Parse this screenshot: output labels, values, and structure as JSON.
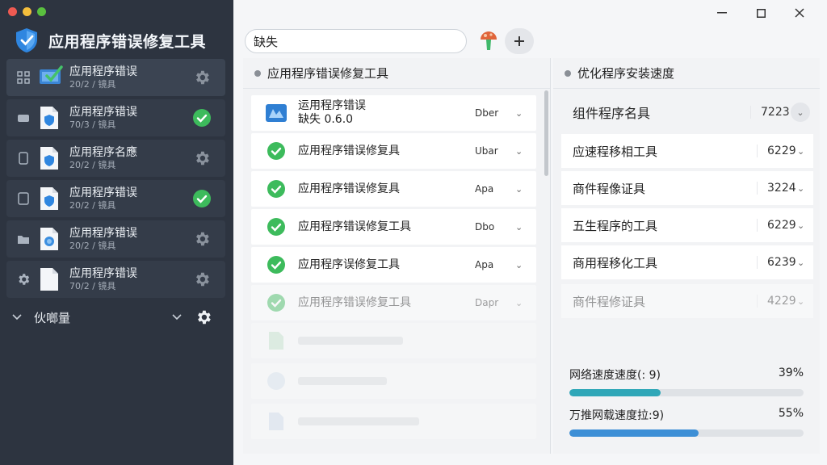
{
  "app": {
    "title": "应用程序错误修复工具"
  },
  "sidebar": {
    "items": [
      {
        "title": "应用程序错误",
        "sub": "20/2 / 镜具",
        "right": "gear-icon",
        "lead": "grid-icon",
        "active": true
      },
      {
        "title": "应用程序错误",
        "sub": "70/3 / 镜具",
        "right": "check-icon",
        "lead": "drive-icon"
      },
      {
        "title": "应用程序名應",
        "sub": "20/2 / 镜具",
        "right": "gear-icon",
        "lead": "phone-icon"
      },
      {
        "title": "应用程序错误",
        "sub": "20/2 / 镜具",
        "right": "check-icon",
        "lead": "tablet-icon"
      },
      {
        "title": "应用程序错误",
        "sub": "20/2 / 镜具",
        "right": "gear-icon",
        "lead": "folder-icon"
      },
      {
        "title": "应用程序错误",
        "sub": "70/2 / 镜具",
        "right": "gear-icon",
        "lead": "gear-icon"
      }
    ],
    "footer_label": "伙啷量"
  },
  "search": {
    "value": "缺失"
  },
  "left_panel": {
    "title": "应用程序错误修复工具",
    "rows": [
      {
        "name": "运用程序错误",
        "name2": "缺失 0.6.0",
        "code": "Dber",
        "icon": "app-icon"
      },
      {
        "name": "应用程序错误修复具",
        "code": "Ubar",
        "icon": "check-icon"
      },
      {
        "name": "应用程序错误修复具",
        "code": "Apa",
        "icon": "check-icon"
      },
      {
        "name": "应用程序错误修复工具",
        "code": "Dbo",
        "icon": "check-icon"
      },
      {
        "name": "应用程序误修复工具",
        "code": "Apa",
        "icon": "check-icon"
      },
      {
        "name": "应用程序错误修复工具",
        "code": "Dapr",
        "icon": "check-icon",
        "faded": true
      }
    ]
  },
  "right_panel": {
    "title": "优化程序安装速度",
    "header": {
      "name": "组件程序名具",
      "value": "7223"
    },
    "rows": [
      {
        "name": "应速程移相工具",
        "value": "6229"
      },
      {
        "name": "商件程像证具",
        "value": "3224"
      },
      {
        "name": "五生程序的工具",
        "value": "6229"
      },
      {
        "name": "商用程移化工具",
        "value": "6239"
      },
      {
        "name": "商件程修证具",
        "value": "4229",
        "faded": true
      }
    ],
    "progress": [
      {
        "label": "网络速度速度(: 9)",
        "value": "39%",
        "fraction": 0.39,
        "color": "#2fa7b8"
      },
      {
        "label": "万推网载速度拉:9)",
        "value": "55%",
        "fraction": 0.55,
        "color": "#3d8fd6"
      }
    ]
  }
}
